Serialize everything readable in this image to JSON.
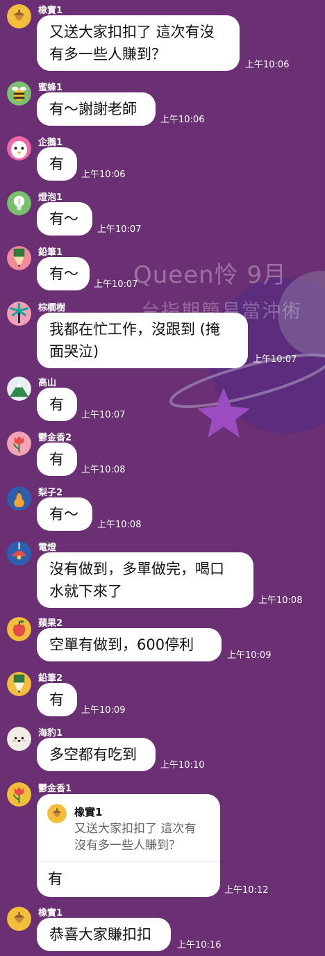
{
  "watermark": {
    "line1": "Queen怜  9月",
    "line2": "台指期簡易當沖術"
  },
  "messages": [
    {
      "sender": "橡實1",
      "icon": "acorn-icon",
      "text": "又送大家扣扣了 這次有沒\n有多一些人賺到？",
      "time": "上午10:06"
    },
    {
      "sender": "蜜蜂1",
      "icon": "bee-icon",
      "text": "有～謝謝老師",
      "time": "上午10:06"
    },
    {
      "sender": "企鵝1",
      "icon": "penguin-icon",
      "text": "有",
      "time": "上午10:06"
    },
    {
      "sender": "燈泡1",
      "icon": "lightbulb-icon",
      "text": "有～",
      "time": "上午10:07"
    },
    {
      "sender": "鉛筆1",
      "icon": "pencil-icon",
      "text": "有～",
      "time": "上午10:07"
    },
    {
      "sender": "棕櫚樹",
      "icon": "palm-tree-icon",
      "text": "我都在忙工作，沒跟到 (掩\n面哭泣)",
      "time": "上午10:07"
    },
    {
      "sender": "高山",
      "icon": "mountain-icon",
      "text": "有",
      "time": "上午10:07"
    },
    {
      "sender": "鬱金香2",
      "icon": "tulip-icon",
      "text": "有",
      "time": "上午10:08"
    },
    {
      "sender": "梨子2",
      "icon": "pear-icon",
      "text": "有～",
      "time": "上午10:08"
    },
    {
      "sender": "電燈",
      "icon": "lamp-icon",
      "text": "沒有做到，多單做完，喝口\n水就下來了",
      "time": "上午10:08"
    },
    {
      "sender": "蘋果2",
      "icon": "apple-icon",
      "text": "空單有做到，600停利",
      "time": "上午10:09"
    },
    {
      "sender": "鉛筆2",
      "icon": "pencil-icon",
      "text": "有",
      "time": "上午10:09"
    },
    {
      "sender": "海豹1",
      "icon": "seal-icon",
      "text": "多空都有吃到",
      "time": "上午10:10"
    },
    {
      "sender": "鬱金香1",
      "icon": "tulip-icon",
      "time": "上午10:12"
    },
    {
      "sender": "橡實1",
      "icon": "acorn-icon",
      "text": "恭喜大家賺扣扣",
      "time": "上午10:16"
    }
  ],
  "reply": {
    "quoted_sender": "橡實1",
    "quoted_text": "又送大家扣扣了 這次有\n沒有多一些人賺到？",
    "text": "有"
  },
  "colors": {
    "background": "#6b2f73",
    "bubble": "#ffffff",
    "planet": "#5b2e7e",
    "star": "#9a4cc0"
  }
}
